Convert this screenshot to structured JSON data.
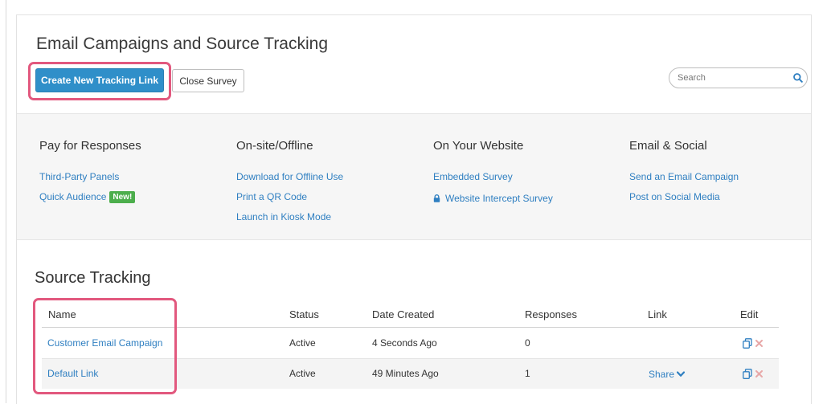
{
  "header": {
    "title": "Email Campaigns and Source Tracking",
    "create_label": "Create New Tracking Link",
    "close_label": "Close Survey",
    "search_placeholder": "Search"
  },
  "sources": [
    {
      "heading": "Pay for Responses",
      "links": [
        {
          "label": "Third-Party Panels"
        },
        {
          "label": "Quick Audience",
          "badge": "New!"
        }
      ]
    },
    {
      "heading": "On-site/Offline",
      "links": [
        {
          "label": "Download for Offline Use"
        },
        {
          "label": "Print a QR Code"
        },
        {
          "label": "Launch in Kiosk Mode"
        }
      ]
    },
    {
      "heading": "On Your Website",
      "links": [
        {
          "label": "Embedded Survey"
        },
        {
          "label": "Website Intercept Survey",
          "icon": "lock-icon"
        }
      ]
    },
    {
      "heading": "Email & Social",
      "links": [
        {
          "label": "Send an Email Campaign"
        },
        {
          "label": "Post on Social Media"
        }
      ]
    }
  ],
  "tracking": {
    "title": "Source Tracking",
    "columns": [
      "Name",
      "Status",
      "Date Created",
      "Responses",
      "Link",
      "Edit"
    ],
    "rows": [
      {
        "name": "Customer Email Campaign",
        "status": "Active",
        "date": "4 Seconds Ago",
        "responses": "0",
        "link": ""
      },
      {
        "name": "Default Link",
        "status": "Active",
        "date": "49 Minutes Ago",
        "responses": "1",
        "link": "Share"
      }
    ]
  },
  "colors": {
    "accent": "#2f8fc9",
    "link": "#2f7fc1",
    "highlight": "#e2587e",
    "badge": "#4cae4c",
    "delete": "#e8a8a8"
  },
  "icons": [
    "search-icon",
    "lock-icon",
    "chevron-down-icon",
    "copy-icon",
    "delete-icon"
  ]
}
